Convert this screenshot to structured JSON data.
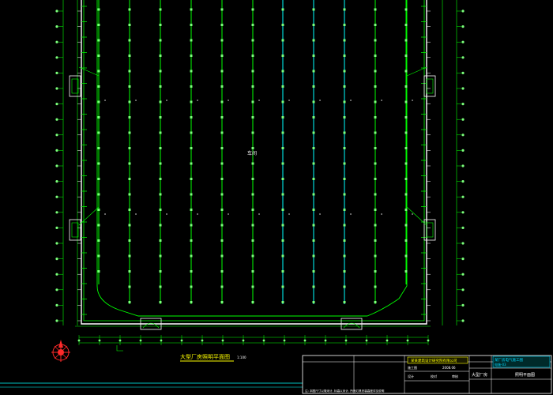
{
  "colors": {
    "background": "#000000",
    "wall_green": "#00ff00",
    "column_cyan": "#00ffff",
    "light_green": "#7cff7c",
    "white": "#ffffff",
    "title_yellow": "#ffff00",
    "north_red": "#ff2a2a",
    "title_block_cyan": "#00d8ff"
  },
  "drawing": {
    "room_label": "车间",
    "plan_title": "大型厂房照明平面图",
    "plan_scale": "1:100"
  },
  "title_block": {
    "company": "某某建筑设计研究院有限公司",
    "project": "某厂房电气施工图",
    "sheet_title": "照明平面图",
    "drawing_name": "大型厂房",
    "sheet_no": "电施-03",
    "date": "2008.06",
    "stage": "施工图",
    "design_label": "设计",
    "check_label": "校对",
    "approve_label": "审核",
    "footer_note": "注: 本图尺寸以毫米计, 标高以米计, 所有灯具安装高度详见说明"
  },
  "icons": [
    "north-arrow-icon"
  ]
}
